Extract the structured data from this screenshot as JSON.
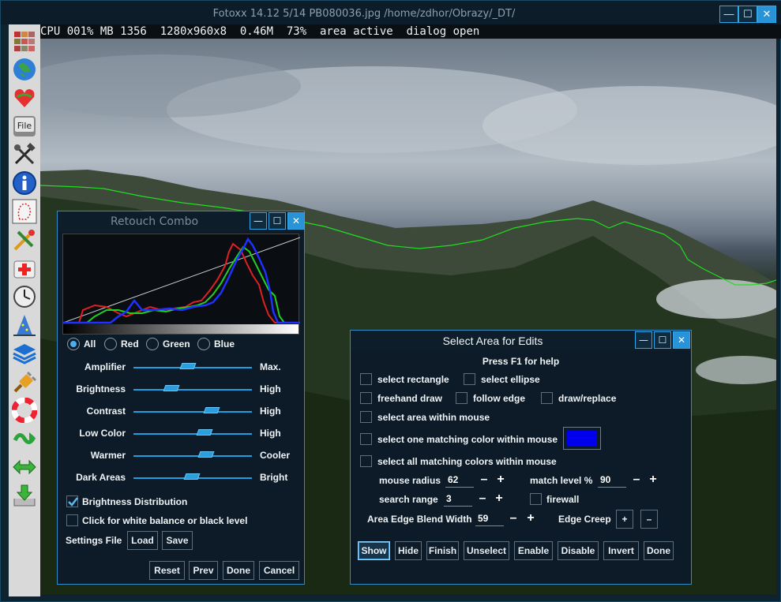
{
  "window": {
    "title": "Fotoxx 14.12  5/14  PB080036.jpg  /home/zdhor/Obrazy/_DT/",
    "minimize": "—",
    "maximize": "☐",
    "close": "✕"
  },
  "status": "CPU 001% MB 1356  1280x960x8  0.46M  73%  area active  dialog open",
  "toolbar": [
    {
      "icon": "gallery-icon"
    },
    {
      "icon": "globe-icon"
    },
    {
      "icon": "favorites-icon"
    },
    {
      "icon": "file-icon",
      "label": "File"
    },
    {
      "icon": "tools-icon"
    },
    {
      "icon": "info-icon"
    },
    {
      "icon": "select-area-icon"
    },
    {
      "icon": "edit-icon"
    },
    {
      "icon": "repair-icon"
    },
    {
      "icon": "clock-icon"
    },
    {
      "icon": "wizard-icon"
    },
    {
      "icon": "layers-icon"
    },
    {
      "icon": "plugin-icon"
    },
    {
      "icon": "help-icon"
    },
    {
      "icon": "undo-redo-icon"
    },
    {
      "icon": "prev-next-icon"
    },
    {
      "icon": "save-icon"
    }
  ],
  "retouch": {
    "title": "Retouch Combo",
    "channels": [
      "All",
      "Red",
      "Green",
      "Blue"
    ],
    "selected_channel": "All",
    "sliders": [
      {
        "label": "Amplifier",
        "right": "Max.",
        "value": 0.46
      },
      {
        "label": "Brightness",
        "right": "High",
        "value": 0.32
      },
      {
        "label": "Contrast",
        "right": "High",
        "value": 0.66
      },
      {
        "label": "Low Color",
        "right": "High",
        "value": 0.6
      },
      {
        "label": "Warmer",
        "right": "Cooler",
        "value": 0.61
      },
      {
        "label": "Dark Areas",
        "right": "Bright",
        "value": 0.49
      }
    ],
    "brightness_distribution": "Brightness Distribution",
    "white_balance": "Click for white balance or black level",
    "settings_file": "Settings File",
    "load": "Load",
    "save": "Save",
    "reset": "Reset",
    "prev": "Prev",
    "done": "Done",
    "cancel": "Cancel"
  },
  "select_area": {
    "title": "Select Area for Edits",
    "help": "Press F1 for help",
    "rectangle": "select rectangle",
    "ellipse": "select ellipse",
    "freehand": "freehand draw",
    "follow_edge": "follow edge",
    "draw_replace": "draw/replace",
    "within_mouse": "select area within mouse",
    "one_color": "select one matching color within mouse",
    "all_colors": "select all matching colors within mouse",
    "swatch_color": "#0000ee",
    "mouse_radius_label": "mouse radius",
    "mouse_radius": "62",
    "match_level_label": "match level %",
    "match_level": "90",
    "search_range_label": "search range",
    "search_range": "3",
    "firewall": "firewall",
    "blend_label": "Area Edge Blend Width",
    "blend_width": "59",
    "edge_creep_label": "Edge Creep",
    "plus": "+",
    "minus": "–",
    "buttons": [
      "Show",
      "Hide",
      "Finish",
      "Unselect",
      "Enable",
      "Disable",
      "Invert",
      "Done"
    ]
  }
}
